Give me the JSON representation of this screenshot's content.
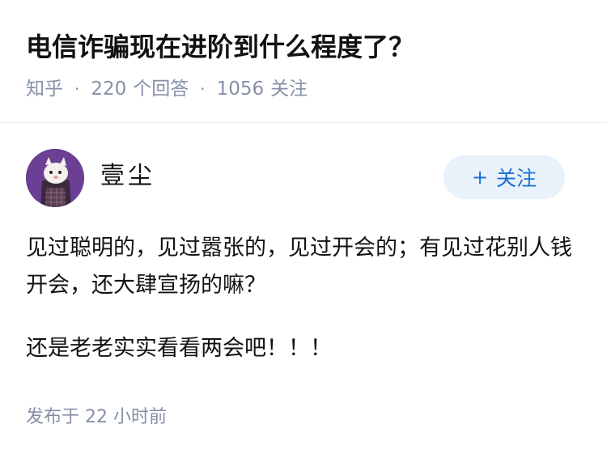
{
  "question": {
    "title": "电信诈骗现在进阶到什么程度了？",
    "source": "知乎",
    "answer_count": "220",
    "answer_label": "个回答",
    "follower_count": "1056",
    "follower_label": "关注"
  },
  "author": {
    "name": "壹尘",
    "avatar_icon": "avatar-icon"
  },
  "follow_button": {
    "plus": "+",
    "label": "关注"
  },
  "answer": {
    "paragraphs": [
      "见过聪明的，见过嚣张的，见过开会的；有见过花别人钱开会，还大肆宣扬的嘛？",
      "还是老老实实看看两会吧！！！"
    ]
  },
  "footer": {
    "publish_label": "发布于",
    "time_ago": "22 小时前"
  },
  "colors": {
    "title_text": "#121212",
    "meta_text": "#8590a6",
    "follow_button_bg": "#e9f1fb",
    "follow_button_text": "#1a6fd6",
    "avatar_bg": "#6a3f94"
  }
}
